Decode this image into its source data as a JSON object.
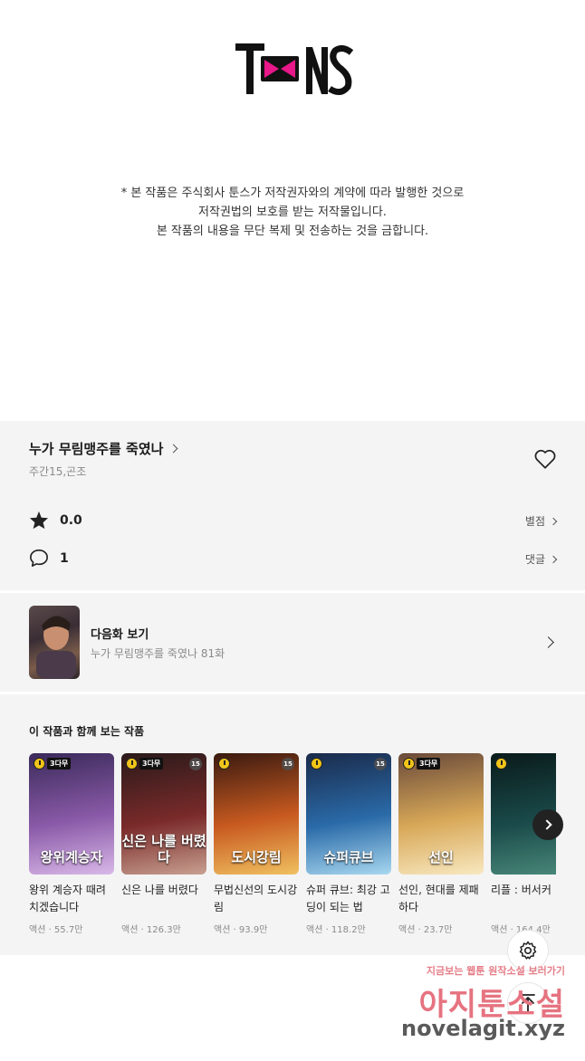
{
  "brand": {
    "logo_text": "ToonS"
  },
  "notice": {
    "lines": [
      "* 본 작품은 주식회사 툰스가 저작권자와의 계약에 따라 발행한 것으로",
      "저작권법의 보호를 받는 저작물입니다.",
      "본 작품의 내용을 무단 복제 및 전송하는 것을 금합니다."
    ]
  },
  "series": {
    "title": "누가 무림맹주를 죽였나",
    "subtitle": "주간15,곤조",
    "rating": "0.0",
    "rating_link": "별점",
    "comments": "1",
    "comments_link": "댓글"
  },
  "next_episode": {
    "label": "다음화 보기",
    "subtitle": "누가 무림맹주를 죽였나 81화"
  },
  "recommendations": {
    "heading": "이 작품과 함께 보는 작품",
    "items": [
      {
        "title": "왕위 계승자 때려치겠습니다",
        "meta": "액션 · 55.7만",
        "badge": "3다무",
        "age": "",
        "cover_text": "왕위계승자",
        "colors": [
          "#3a2a5a",
          "#8a5aa8",
          "#d8b8e8"
        ]
      },
      {
        "title": "신은 나를 버렸다",
        "meta": "액션 · 126.3만",
        "badge": "3다무",
        "age": "15",
        "cover_text": "신은 나를 버렸다",
        "colors": [
          "#2a1a1a",
          "#7a2a2a",
          "#c8a090"
        ]
      },
      {
        "title": "무법신선의 도시강림",
        "meta": "액션 · 93.9만",
        "badge": "",
        "age": "15",
        "cover_text": "도시강림",
        "colors": [
          "#3a1a10",
          "#c85a20",
          "#f0c060"
        ]
      },
      {
        "title": "슈퍼 큐브: 최강 고딩이 되는 법",
        "meta": "액션 · 118.2만",
        "badge": "",
        "age": "15",
        "cover_text": "슈퍼큐브",
        "colors": [
          "#1a2a4a",
          "#2a6aa8",
          "#a8d8f0"
        ]
      },
      {
        "title": "선인, 현대를 제패하다",
        "meta": "액션 · 23.7만",
        "badge": "3다무",
        "age": "",
        "cover_text": "선인",
        "colors": [
          "#6a4a3a",
          "#d8a858",
          "#f8e8c0"
        ]
      },
      {
        "title": "리플 : 버서커",
        "meta": "액션 · 164.4만",
        "badge": "",
        "age": "",
        "cover_text": "",
        "colors": [
          "#0a1a1a",
          "#1a4a4a",
          "#4a8a7a"
        ]
      }
    ]
  },
  "watermark": {
    "line1": "지금보는 웹툰 원작소설 보러가기",
    "line2": "아지툰소설",
    "line3": "novelagit.xyz"
  }
}
